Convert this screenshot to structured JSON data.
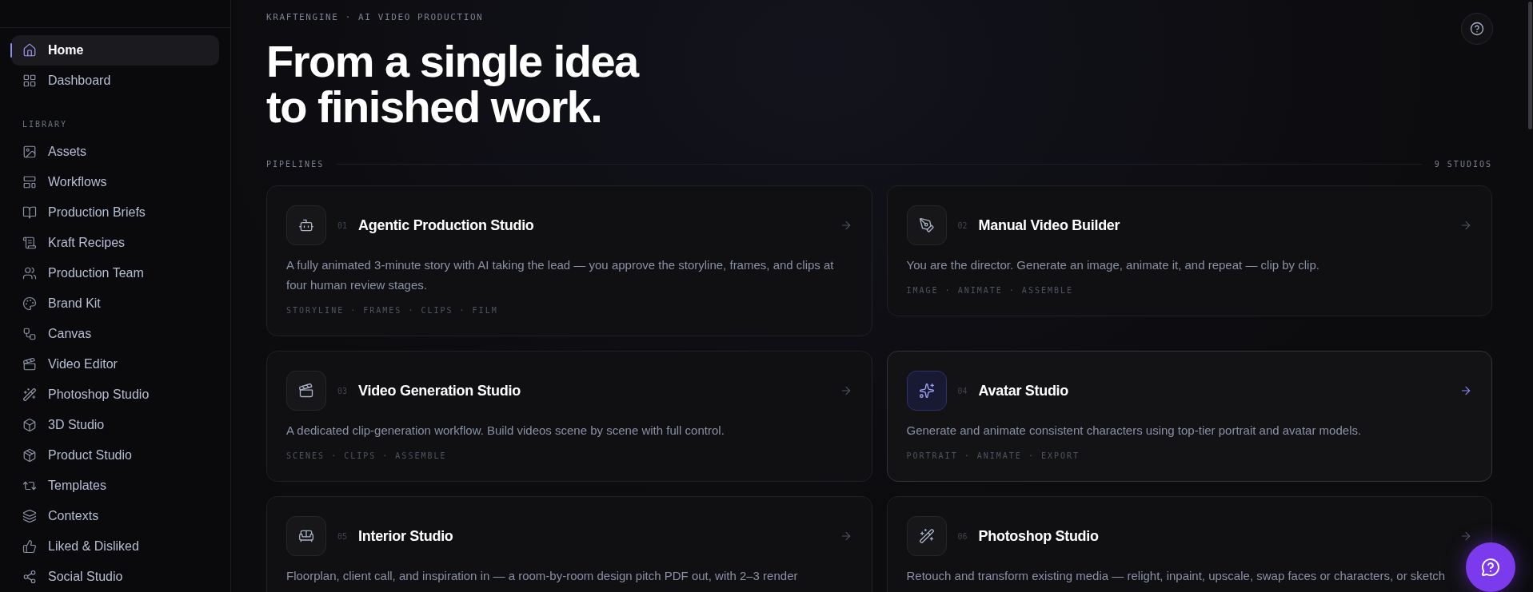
{
  "sidebar": {
    "main_items": [
      {
        "label": "Home",
        "selected": true
      },
      {
        "label": "Dashboard",
        "selected": false
      }
    ],
    "section_label": "LIBRARY",
    "library_items": [
      {
        "label": "Assets",
        "selected": false
      },
      {
        "label": "Workflows",
        "selected": false
      },
      {
        "label": "Production Briefs",
        "selected": false
      },
      {
        "label": "Kraft Recipes",
        "selected": false
      },
      {
        "label": "Production Team",
        "selected": false
      },
      {
        "label": "Brand Kit",
        "selected": false
      },
      {
        "label": "Canvas",
        "selected": false
      },
      {
        "label": "Video Editor",
        "selected": false
      },
      {
        "label": "Photoshop Studio",
        "selected": false
      },
      {
        "label": "3D Studio",
        "selected": false
      },
      {
        "label": "Product Studio",
        "selected": false
      },
      {
        "label": "Templates",
        "selected": false
      },
      {
        "label": "Contexts",
        "selected": false
      },
      {
        "label": "Liked & Disliked",
        "selected": false
      },
      {
        "label": "Social Studio",
        "selected": false
      }
    ]
  },
  "header": {
    "eyebrow": "KRAFTENGINE · AI VIDEO PRODUCTION",
    "headline_lines": [
      "From a single idea",
      "to finished work."
    ]
  },
  "pipelines": {
    "label": "PIPELINES",
    "count": "9 STUDIOS",
    "cards": [
      {
        "number": "01",
        "title": "Agentic Production Studio",
        "description": "A fully animated 3-minute story with AI taking the lead — you approve the storyline, frames, and clips at four human review stages.",
        "steps": "STORYLINE · FRAMES · CLIPS · FILM",
        "selected": false
      },
      {
        "number": "02",
        "title": "Manual Video Builder",
        "description": "You are the director. Generate an image, animate it, and repeat — clip by clip.",
        "steps": "IMAGE · ANIMATE · ASSEMBLE",
        "selected": false
      },
      {
        "number": "03",
        "title": "Video Generation Studio",
        "description": "A dedicated clip-generation workflow. Build videos scene by scene with full control.",
        "steps": "SCENES · CLIPS · ASSEMBLE",
        "selected": false
      },
      {
        "number": "04",
        "title": "Avatar Studio",
        "description": "Generate and animate consistent characters using top-tier portrait and avatar models.",
        "steps": "PORTRAIT · ANIMATE · EXPORT",
        "selected": true
      },
      {
        "number": "05",
        "title": "Interior Studio",
        "description": "Floorplan, client call, and inspiration in — a room-by-room design pitch PDF out, with 2–3 render",
        "selected": false
      },
      {
        "number": "06",
        "title": "Photoshop Studio",
        "description": "Retouch and transform existing media — relight, inpaint, upscale, swap faces or characters, or sketch",
        "selected": false
      }
    ]
  }
}
